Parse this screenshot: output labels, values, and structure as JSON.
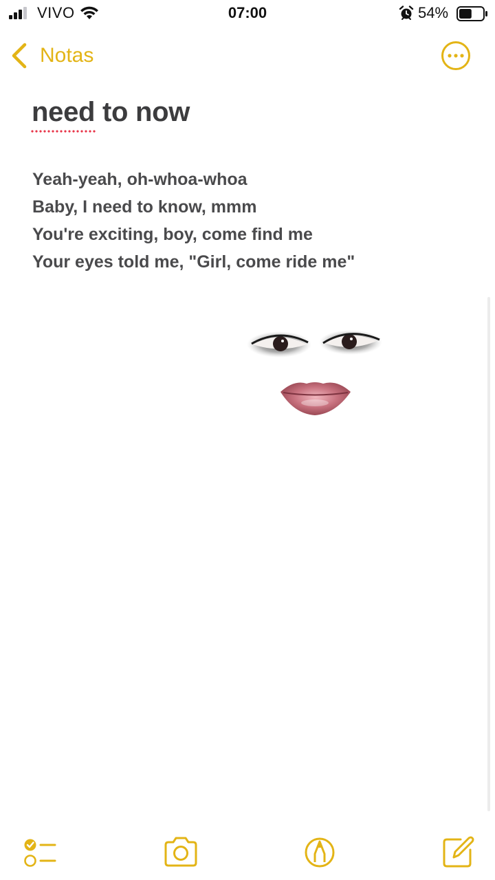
{
  "status_bar": {
    "carrier": "VIVO",
    "time": "07:00",
    "battery_percent": "54%",
    "battery_level": 0.54,
    "icons": [
      "signal-bars-icon",
      "wifi-icon",
      "alarm-icon",
      "battery-icon"
    ]
  },
  "nav": {
    "back_label": "Notas",
    "back_icon": "chevron-left-icon",
    "more_icon": "ellipsis-circle-icon"
  },
  "note": {
    "title_misspelled": "need",
    "title_rest": " to now",
    "lines": [
      "Yeah-yeah, oh-whoa-whoa",
      "Baby, I need to know, mmm",
      "You're exciting, boy, come find me",
      "Your eyes told me, \"Girl, come ride me\""
    ]
  },
  "toolbar": {
    "icons": [
      "checklist-icon",
      "camera-icon",
      "markup-pen-icon",
      "compose-icon"
    ]
  },
  "colors": {
    "accent": "#e3b416",
    "text": "#3c3c3e",
    "spellcheck": "#e8364a",
    "background": "#ffffff"
  }
}
